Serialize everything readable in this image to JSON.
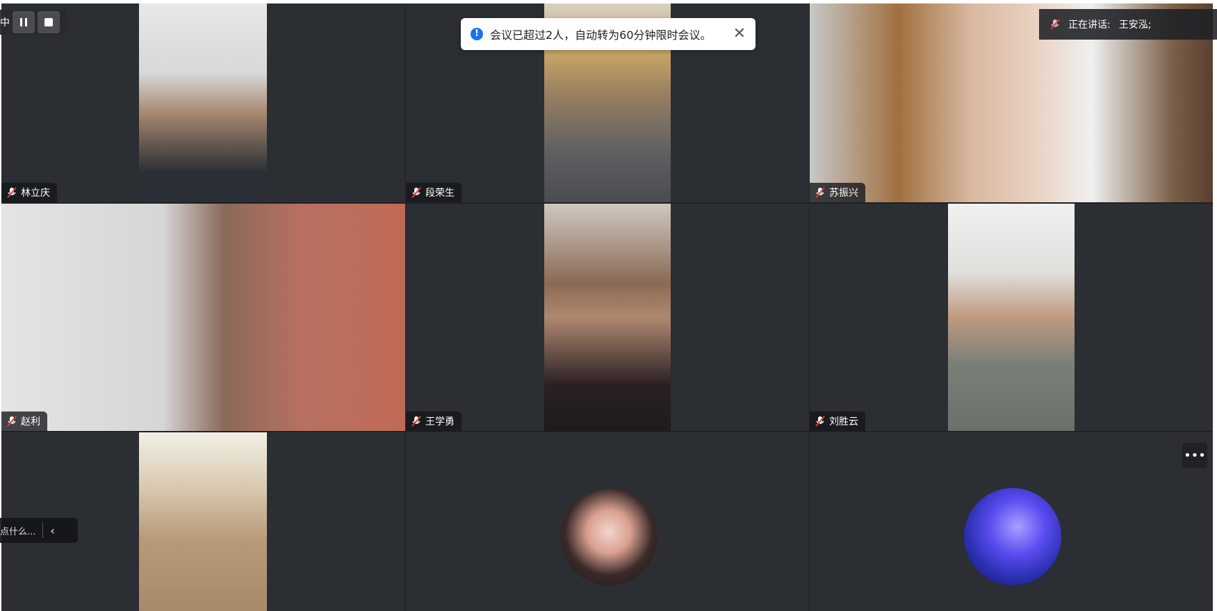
{
  "toast": {
    "message": "会议已超过2人，自动转为60分钟限时会议。",
    "close_icon": "close-icon"
  },
  "speaking": {
    "label": "正在讲话:",
    "name": "王安泓;"
  },
  "recording": {
    "status_char": "中"
  },
  "chat": {
    "placeholder": "点什么..."
  },
  "participants": [
    {
      "name": "林立庆",
      "muted": true
    },
    {
      "name": "段荣生",
      "muted": true
    },
    {
      "name": "苏振兴",
      "muted": true
    },
    {
      "name": "赵利",
      "muted": true
    },
    {
      "name": "王学勇",
      "muted": true
    },
    {
      "name": "刘胜云",
      "muted": true
    },
    {
      "name": "",
      "muted": true
    },
    {
      "name": "",
      "muted": true
    },
    {
      "name": "",
      "muted": true
    }
  ],
  "colors": {
    "toast_info": "#1a73e8",
    "tile_bg": "#2b2e33",
    "grid_bg": "#1f2125"
  }
}
